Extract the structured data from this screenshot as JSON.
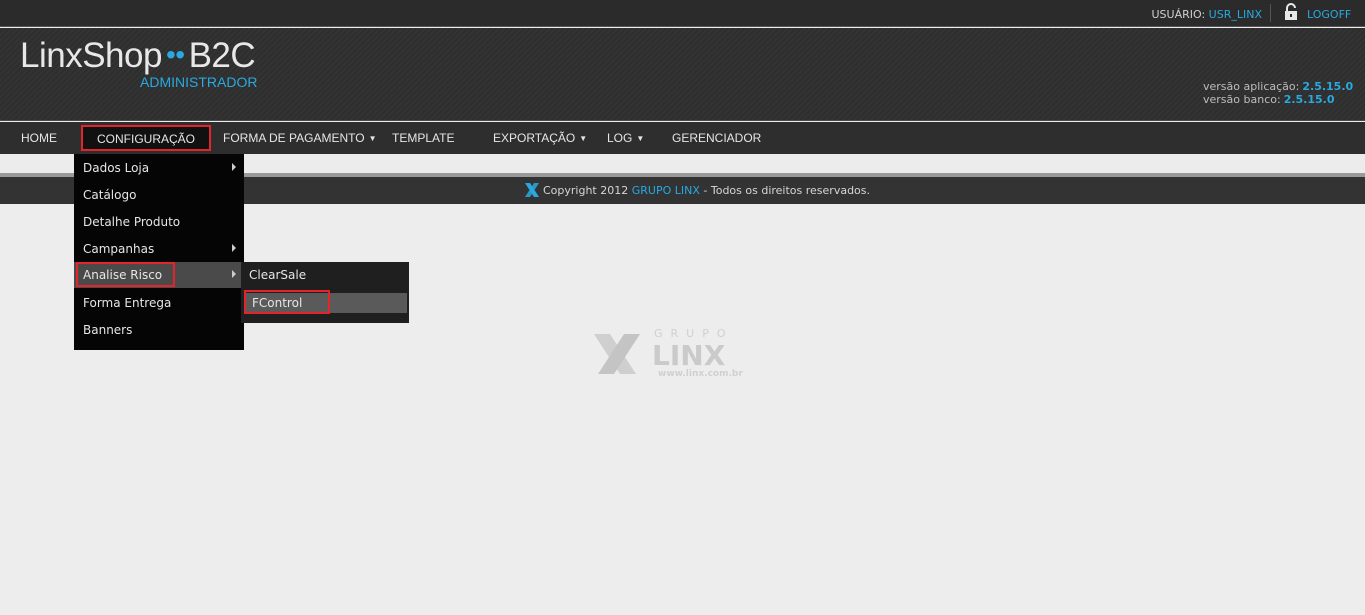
{
  "topbar": {
    "user_label": "USUÁRIO:",
    "user_name": "USR_LINX",
    "logoff": "LOGOFF"
  },
  "header": {
    "logo_left": "LinxShop",
    "logo_dots": "••",
    "logo_right": "B2C",
    "logo_sub": "ADMINISTRADOR",
    "app_version_label": "versão aplicação:",
    "app_version": "2.5.15.0",
    "db_version_label": "versão banco:",
    "db_version": "2.5.15.0"
  },
  "nav": {
    "home": "HOME",
    "config": "CONFIGURAÇÃO",
    "payment": "FORMA DE PAGAMENTO",
    "template": "TEMPLATE",
    "export": "EXPORTAÇÃO",
    "log": "LOG",
    "manager": "GERENCIADOR"
  },
  "dropdown": {
    "items": [
      "Dados Loja",
      "Catálogo",
      "Detalhe Produto",
      "Campanhas",
      "Analise Risco",
      "Forma Entrega",
      "Banners"
    ]
  },
  "submenu": {
    "items": [
      "ClearSale",
      "FControl"
    ]
  },
  "footer": {
    "prefix": "Copyright 2012 ",
    "brand": "GRUPO LINX",
    "suffix": " - Todos os direitos reservados."
  },
  "watermark": {
    "grupo": "GRUPO",
    "linx": "LINX",
    "url": "www.linx.com.br"
  },
  "colors": {
    "accent": "#29a9e0",
    "highlight_border": "#e3242b"
  }
}
